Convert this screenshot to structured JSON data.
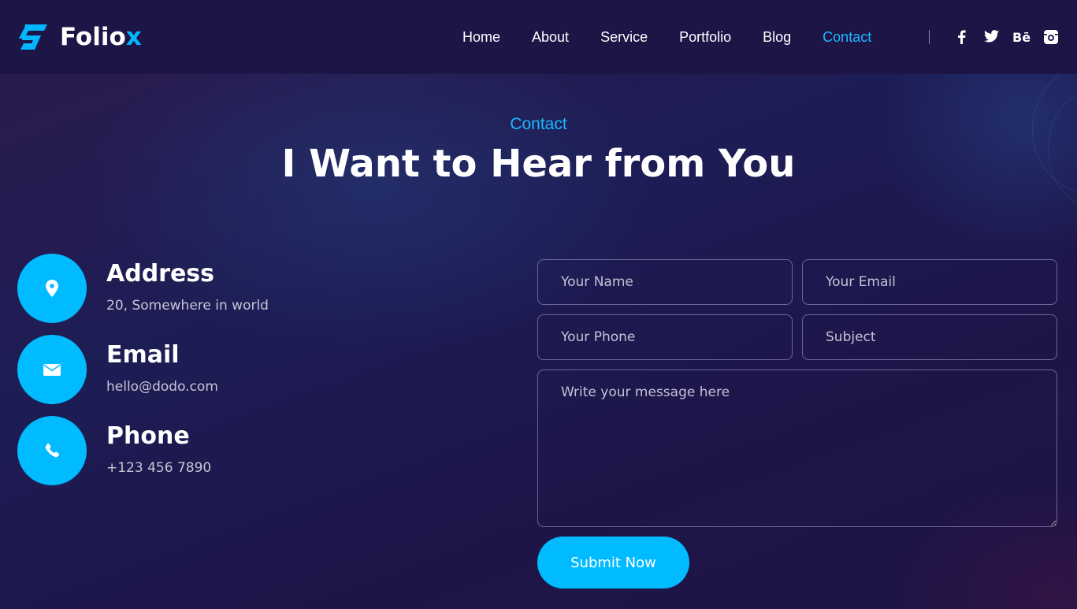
{
  "brand": {
    "name_main": "Folio",
    "name_accent": "x",
    "accent_color": "#00b7ff"
  },
  "nav": {
    "items": [
      {
        "label": "Home",
        "active": false
      },
      {
        "label": "About",
        "active": false
      },
      {
        "label": "Service",
        "active": false
      },
      {
        "label": "Portfolio",
        "active": false
      },
      {
        "label": "Blog",
        "active": false
      },
      {
        "label": "Contact",
        "active": true
      }
    ],
    "social": [
      {
        "icon": "facebook-icon",
        "glyph": "f"
      },
      {
        "icon": "twitter-icon",
        "glyph": "🐦"
      },
      {
        "icon": "behance-icon",
        "glyph": "Bē"
      },
      {
        "icon": "instagram-icon",
        "glyph": "◙"
      }
    ]
  },
  "section": {
    "eyebrow": "Contact",
    "title": "I Want to Hear from You"
  },
  "contact_info": [
    {
      "icon": "location-pin-icon",
      "title": "Address",
      "value": "20, Somewhere in world"
    },
    {
      "icon": "envelope-icon",
      "title": "Email",
      "value": "hello@dodo.com"
    },
    {
      "icon": "phone-icon",
      "title": "Phone",
      "value": "+123 456 7890"
    }
  ],
  "form": {
    "name_placeholder": "Your Name",
    "email_placeholder": "Your Email",
    "phone_placeholder": "Your Phone",
    "subject_placeholder": "Subject",
    "message_placeholder": "Write your message here",
    "submit_label": "Submit Now"
  },
  "colors": {
    "accent": "#00bbff",
    "background": "#1f1448",
    "field_border": "#6d6796"
  }
}
